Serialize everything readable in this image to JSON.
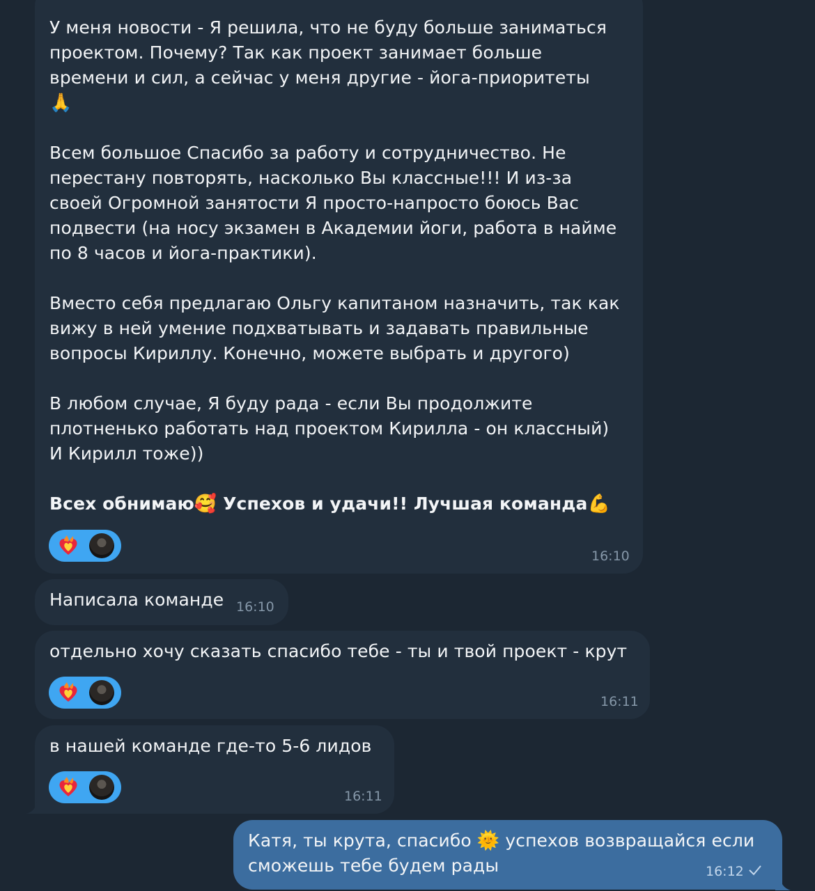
{
  "messages": [
    {
      "paragraphs": [
        "У меня новости - Я решила, что не буду больше заниматься\nпроектом. Почему? Так как проект занимает больше\nвремени и сил, а сейчас у меня другие - йога-приоритеты",
        "Всем большое Спасибо за работу и сотрудничество. Не\nперестану повторять, насколько Вы классные!!! И из-за\nсвоей Огромной занятости Я просто-напросто боюсь Вас\nподвести (на носу экзамен в Академии йоги, работа в найме\nпо 8 часов и йога-практики).",
        "Вместо себя предлагаю Ольгу капитаном назначить, так как\nвижу в ней умение подхватывать и задавать правильные\nвопросы Кириллу. Конечно, можете выбрать и другого)",
        "В любом случае, Я буду рада - если Вы продолжите\nплотненько работать над проектом Кирилла - он классный)\nИ Кирилл тоже))"
      ],
      "pray_emoji": "🙏",
      "bold_part1": "Всех обнимаю",
      "bold_emoji1": "🥰",
      "bold_part2": " Успехов и удачи!! Лучшая команда",
      "bold_emoji2": "💪",
      "time": "16:10",
      "reaction": "heart-on-fire"
    },
    {
      "text": "Написала команде",
      "time": "16:10"
    },
    {
      "text": "отдельно хочу сказать спасибо тебе - ты и твой проект - крут",
      "time": "16:11",
      "reaction": "heart-on-fire"
    },
    {
      "text": "в нашей команде где-то 5-6 лидов",
      "time": "16:11",
      "reaction": "heart-on-fire"
    },
    {
      "text_part1": "Катя, ты крута, спасибо ",
      "emoji": "🌞",
      "text_part2": " успехов возвращайся если\nсможешь тебе будем рады",
      "time": "16:12",
      "status": "sent-check"
    }
  ],
  "colors": {
    "background": "#1c2733",
    "incoming_bubble": "#222f3d",
    "outgoing_bubble": "#3c6d9f",
    "reaction": "#3fa6f2",
    "time": "#8597a8"
  }
}
